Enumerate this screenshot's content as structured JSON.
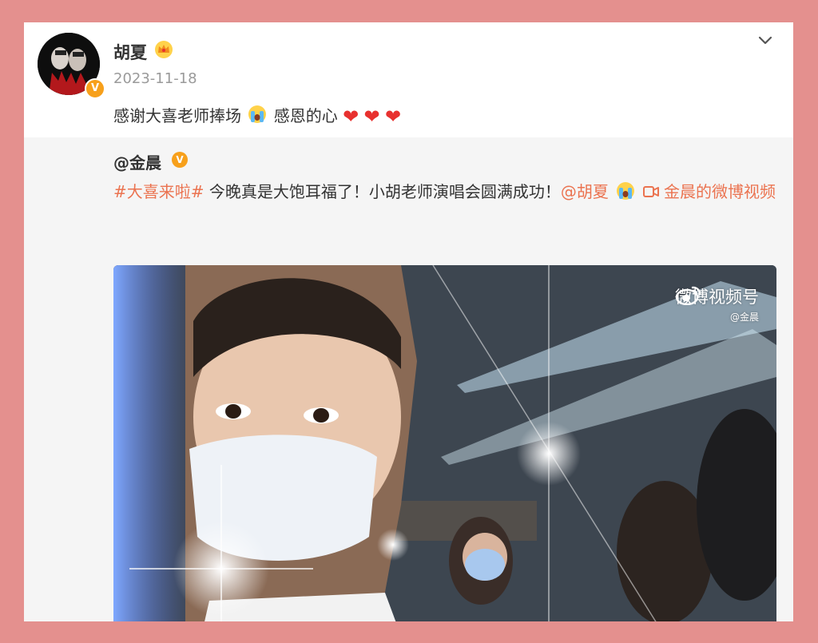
{
  "post": {
    "author": "胡夏",
    "date": "2023-11-18",
    "text_before": "感谢大喜老师捧场",
    "text_after": "感恩的心",
    "hearts": [
      "❤",
      "❤",
      "❤"
    ]
  },
  "repost": {
    "author": "@金晨",
    "verified_mark": "V",
    "hashtag": "#大喜来啦#",
    "body": " 今晚真是大饱耳福了！小胡老师演唱会圆满成功！",
    "mention": "@胡夏",
    "video_link": "金晨的微博视频"
  },
  "video": {
    "watermark_brand": "微博视频号",
    "watermark_handle": "@金晨"
  },
  "colors": {
    "background": "#e4908e",
    "link": "#eb7350",
    "verified": "#f7a01b",
    "heart": "#e8312f"
  },
  "icons": [
    "verified-icon",
    "crown-badge-icon",
    "chevron-down-icon",
    "crying-emoji-icon",
    "heart-icon",
    "video-link-icon",
    "weibo-logo-icon"
  ]
}
